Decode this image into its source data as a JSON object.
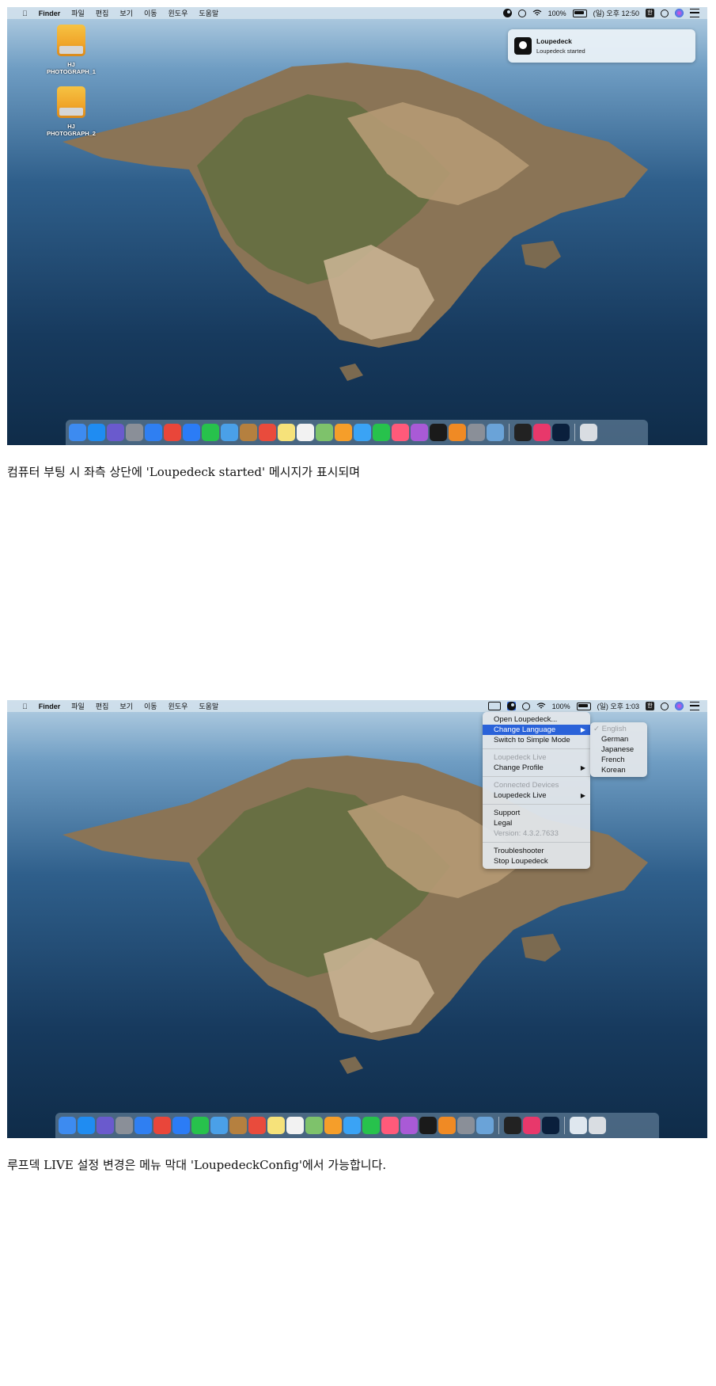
{
  "screenshot1": {
    "menubar": {
      "app_name": "Finder",
      "menus": [
        "파일",
        "편집",
        "보기",
        "이동",
        "윈도우",
        "도움말"
      ],
      "battery": "100%",
      "clock": "(일) 오후 12:50",
      "input_method": "한"
    },
    "desktop_drives": [
      {
        "line1": "HJ",
        "line2": "PHOTOGRAPH_1"
      },
      {
        "line1": "HJ",
        "line2": "PHOTOGRAPH_2"
      }
    ],
    "notification": {
      "title": "Loupedeck",
      "body": "Loupedeck started"
    }
  },
  "caption1": "컴퓨터 부팅 시 좌측 상단에 'Loupedeck started' 메시지가 표시되며",
  "screenshot2": {
    "menubar": {
      "app_name": "Finder",
      "menus": [
        "파일",
        "편집",
        "보기",
        "이동",
        "윈도우",
        "도움말"
      ],
      "battery": "100%",
      "clock": "(일) 오후 1:03",
      "input_method": "한"
    },
    "loupedeck_menu": {
      "open": "Open Loupedeck...",
      "change_language": "Change Language",
      "simple_mode": "Switch to Simple Mode",
      "live_header": "Loupedeck Live",
      "change_profile": "Change Profile",
      "connected_header": "Connected Devices",
      "device_live": "Loupedeck Live",
      "support": "Support",
      "legal": "Legal",
      "version": "Version: 4.3.2.7633",
      "troubleshooter": "Troubleshooter",
      "stop": "Stop Loupedeck"
    },
    "language_submenu": {
      "checkmark": "✓",
      "items": [
        "English",
        "German",
        "Japanese",
        "French",
        "Korean"
      ]
    }
  },
  "caption2": "루프덱 LIVE 설정 변경은 메뉴 막대 'LoupedeckConfig'에서 가능합니다.",
  "colors": {
    "menu_highlight": "#2a62d9",
    "drive_orange": "#f0a52a",
    "sea_dark": "#173a5e"
  }
}
